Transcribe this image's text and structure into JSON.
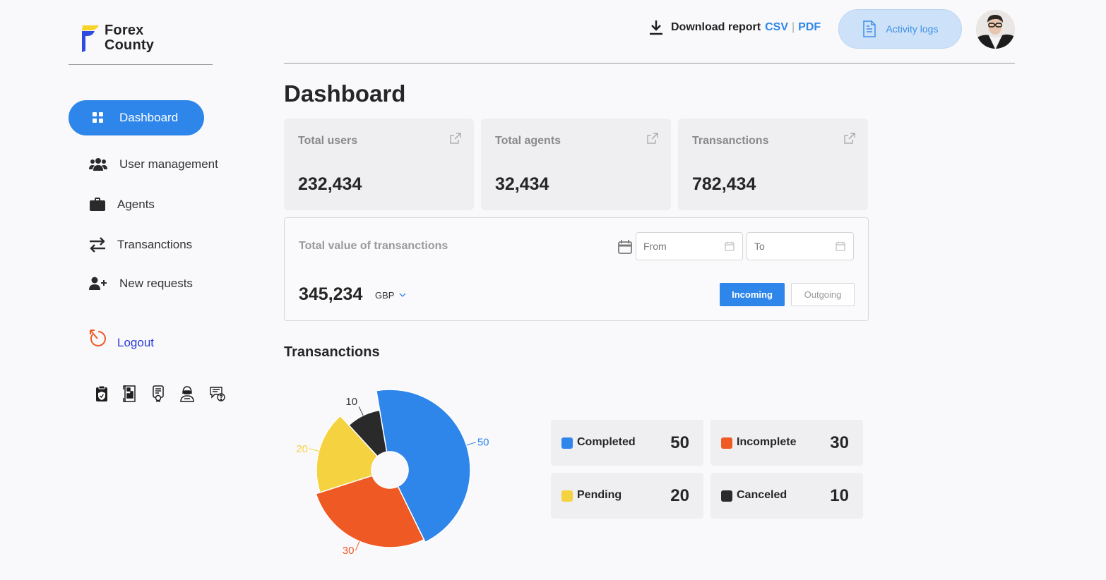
{
  "app": {
    "logo_line1": "Forex",
    "logo_line2": "County",
    "accent_color": "#2f86ea"
  },
  "sidebar": {
    "items": [
      {
        "label": "Dashboard",
        "icon": "grid-icon",
        "active": true
      },
      {
        "label": "User management",
        "icon": "users-icon"
      },
      {
        "label": "Agents",
        "icon": "briefcase-icon"
      },
      {
        "label": "Transanctions",
        "icon": "arrows-exchange-icon"
      },
      {
        "label": "New requests",
        "icon": "user-plus-icon"
      }
    ],
    "logout_label": "Logout",
    "tool_icons": [
      "clipboard-shield-icon",
      "qr-document-icon",
      "certificate-icon",
      "hacker-icon",
      "chat-question-icon"
    ]
  },
  "header": {
    "download_label": "Download report",
    "csv_label": "CSV",
    "separator": "|",
    "pdf_label": "PDF",
    "activity_label": "Activity logs"
  },
  "main": {
    "title": "Dashboard",
    "stats": [
      {
        "label": "Total users",
        "value": "232,434"
      },
      {
        "label": "Total agents",
        "value": "32,434"
      },
      {
        "label": "Transanctions",
        "value": "782,434"
      }
    ],
    "value_panel": {
      "label": "Total value of transanctions",
      "from_placeholder": "From",
      "to_placeholder": "To",
      "amount": "345,234",
      "currency": "GBP",
      "incoming_label": "Incoming",
      "outgoing_label": "Outgoing"
    },
    "transactions_title": "Transanctions"
  },
  "chart_data": {
    "type": "pie",
    "title": "Transanctions",
    "categories": [
      "Completed",
      "Incomplete",
      "Pending",
      "Canceled"
    ],
    "values": [
      50,
      30,
      20,
      10
    ],
    "colors": [
      "#2f86ea",
      "#ef5a24",
      "#f5d23f",
      "#2a2a2a"
    ],
    "legend_placement": "right"
  }
}
